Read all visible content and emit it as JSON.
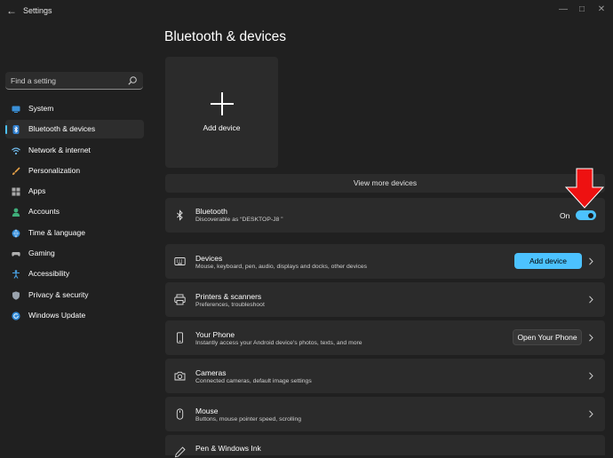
{
  "window": {
    "title": "Settings"
  },
  "search": {
    "placeholder": "Find a setting"
  },
  "nav": [
    {
      "label": "System",
      "icon": "system-icon",
      "selected": false
    },
    {
      "label": "Bluetooth & devices",
      "icon": "bluetooth-icon",
      "selected": true
    },
    {
      "label": "Network & internet",
      "icon": "wifi-icon",
      "selected": false
    },
    {
      "label": "Personalization",
      "icon": "brush-icon",
      "selected": false
    },
    {
      "label": "Apps",
      "icon": "apps-icon",
      "selected": false
    },
    {
      "label": "Accounts",
      "icon": "person-icon",
      "selected": false
    },
    {
      "label": "Time & language",
      "icon": "globe-icon",
      "selected": false
    },
    {
      "label": "Gaming",
      "icon": "controller-icon",
      "selected": false
    },
    {
      "label": "Accessibility",
      "icon": "accessibility-icon",
      "selected": false
    },
    {
      "label": "Privacy & security",
      "icon": "shield-icon",
      "selected": false
    },
    {
      "label": "Windows Update",
      "icon": "update-icon",
      "selected": false
    }
  ],
  "main": {
    "title": "Bluetooth & devices",
    "add_tile_label": "Add device",
    "view_more_label": "View more devices",
    "bluetooth": {
      "title": "Bluetooth",
      "subtitle": "Discoverable as “DESKTOP-J8 ”",
      "state_label": "On",
      "enabled": true
    },
    "rows": [
      {
        "title": "Devices",
        "subtitle": "Mouse, keyboard, pen, audio, displays and docks, other devices",
        "button": "Add device",
        "icon": "keyboard-icon"
      },
      {
        "title": "Printers & scanners",
        "subtitle": "Preferences, troubleshoot",
        "icon": "printer-icon"
      },
      {
        "title": "Your Phone",
        "subtitle": "Instantly access your Android device's photos, texts, and more",
        "button": "Open Your Phone",
        "icon": "phone-icon"
      },
      {
        "title": "Cameras",
        "subtitle": "Connected cameras, default image settings",
        "icon": "camera-icon"
      },
      {
        "title": "Mouse",
        "subtitle": "Buttons, mouse pointer speed, scrolling",
        "icon": "mouse-icon"
      },
      {
        "title": "Pen & Windows Ink",
        "subtitle": "",
        "icon": "pen-icon"
      }
    ]
  },
  "colors": {
    "accent": "#4cc2ff",
    "background": "#202020",
    "card": "#2b2b2b",
    "annotation_arrow": "#ee1111"
  }
}
